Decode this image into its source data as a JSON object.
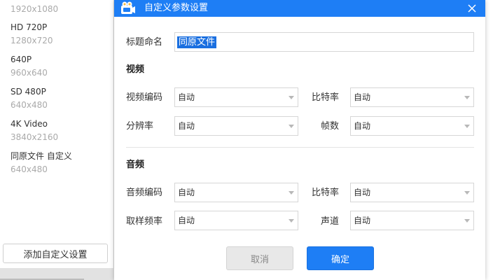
{
  "presets": [
    {
      "name": "",
      "resolution": "1920x1080"
    },
    {
      "name": "HD 720P",
      "resolution": "1280x720"
    },
    {
      "name": "640P",
      "resolution": "960x640"
    },
    {
      "name": "SD 480P",
      "resolution": "640x480"
    },
    {
      "name": "4K Video",
      "resolution": "3840x2160"
    },
    {
      "name": "同原文件 自定义",
      "resolution": "640x480"
    }
  ],
  "add_button_label": "添加自定义设置",
  "dialog": {
    "title": "自定义参数设置",
    "title_label": "标题命名",
    "title_value": "同原文件",
    "video_section": "视频",
    "audio_section": "音频",
    "video": {
      "codec_label": "视频编码",
      "codec_value": "自动",
      "bitrate_label": "比特率",
      "bitrate_value": "自动",
      "resolution_label": "分辨率",
      "resolution_value": "自动",
      "framerate_label": "帧数",
      "framerate_value": "自动"
    },
    "audio": {
      "codec_label": "音频编码",
      "codec_value": "自动",
      "bitrate_label": "比特率",
      "bitrate_value": "自动",
      "samplerate_label": "取样频率",
      "samplerate_value": "自动",
      "channel_label": "声道",
      "channel_value": "自动"
    },
    "cancel_label": "取消",
    "ok_label": "确定"
  },
  "colors": {
    "accent": "#1e7ef5",
    "selection": "#1a6fe0"
  },
  "icons": {
    "app": "video-camera-icon",
    "close": "close-icon",
    "dropdown": "chevron-down-icon"
  }
}
